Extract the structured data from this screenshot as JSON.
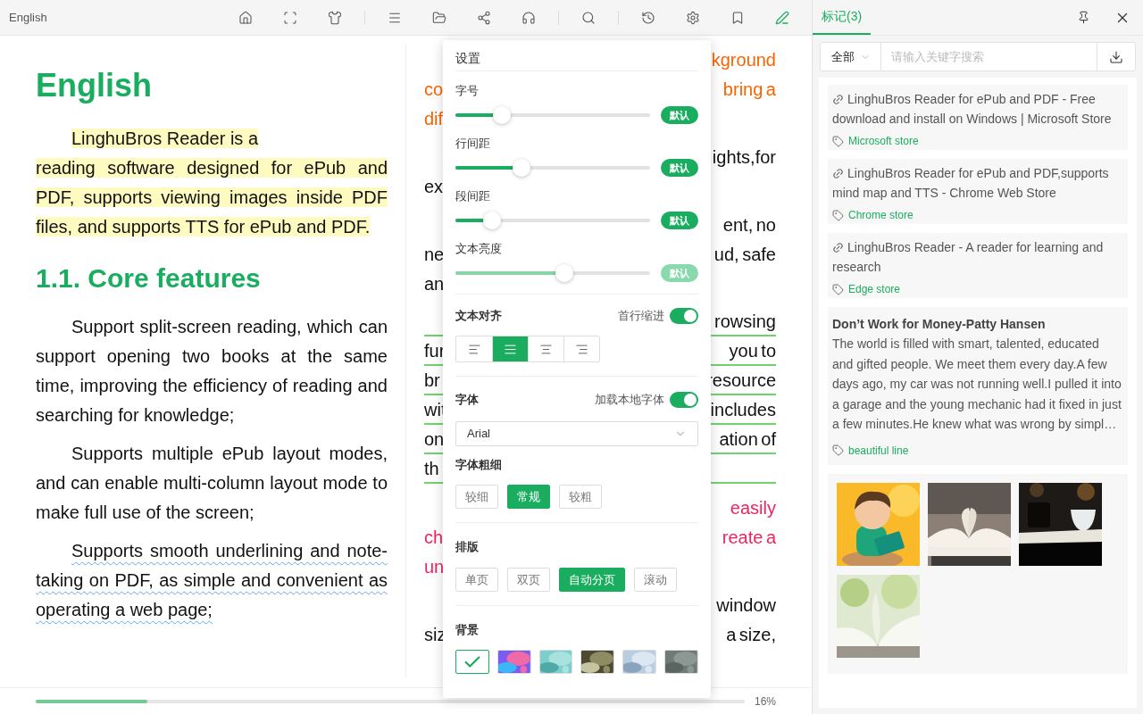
{
  "toolbar": {
    "title": "English",
    "tool_groups": [
      [
        {
          "kind": "home",
          "selected": false
        },
        {
          "kind": "fullscreen",
          "selected": false
        },
        {
          "kind": "theme",
          "selected": false
        }
      ],
      [
        {
          "kind": "contents",
          "selected": false
        },
        {
          "kind": "files",
          "selected": false
        },
        {
          "kind": "mindmap",
          "selected": false
        },
        {
          "kind": "listen",
          "selected": false
        }
      ],
      [
        {
          "kind": "search",
          "selected": false
        }
      ],
      [
        {
          "kind": "history",
          "selected": false
        },
        {
          "kind": "settings",
          "selected": false
        },
        {
          "kind": "bookmark",
          "selected": false
        },
        {
          "kind": "annotate",
          "selected": true
        }
      ]
    ]
  },
  "reader": {
    "left_column": [
      {
        "kind": "heading1",
        "text": "English"
      },
      {
        "kind": "highlight",
        "text": "LinghuBros Reader is a\nreading software designed for ePub and PDF, supports viewing images inside PDF files, and supports TTS for ePub and PDF."
      },
      {
        "kind": "heading2",
        "text": "1.1. Core features"
      },
      {
        "kind": "plain",
        "text": "Support split-screen reading, which can support opening two books at the same time, improving the efficiency of reading and searching for knowledge;"
      },
      {
        "kind": "plain",
        "text": "Supports multiple ePub layout modes, and can enable multi-column layout mode to make full use of the screen;"
      },
      {
        "kind": "wavy",
        "text": "Supports smooth underlining and note-taking on PDF, as simple and convenient as operating a web page;"
      }
    ],
    "right_column": [
      {
        "kind": "orange",
        "lines": [
          {
            "right": "kground"
          },
          {
            "left": "co",
            "right": "bring a"
          },
          {
            "left": "dif"
          }
        ]
      },
      {
        "kind": "plain",
        "lines": [
          {
            "right": "ights,for"
          },
          {
            "left": "ex"
          }
        ]
      },
      {
        "kind": "plain",
        "lines": [
          {
            "right": "ent, no"
          },
          {
            "left": "ne",
            "right": "ud, safe"
          },
          {
            "left": "an"
          }
        ]
      },
      {
        "kind": "underline",
        "lines": [
          {
            "right": "rowsing"
          },
          {
            "left": "fur",
            "right": "you to"
          },
          {
            "left": "br",
            "right": "resource"
          },
          {
            "left": "wit",
            "right": "includes"
          },
          {
            "left": "on",
            "right": "ation of"
          },
          {
            "left": "th"
          }
        ]
      },
      {
        "kind": "pink",
        "lines": [
          {
            "right": "easily"
          },
          {
            "left": "ch",
            "right": "reate a"
          },
          {
            "left": "un"
          }
        ]
      },
      {
        "kind": "plain",
        "lines": [
          {
            "right": "window"
          },
          {
            "left": "siz",
            "right": "a size,"
          }
        ]
      }
    ]
  },
  "progress": {
    "level": 0.157,
    "percent": "16%"
  },
  "settings": {
    "title": "设置",
    "sliders": [
      {
        "label": "字号",
        "level": 0.24,
        "reset": "默认",
        "dimmed": false
      },
      {
        "label": "行间距",
        "level": 0.34,
        "reset": "默认",
        "dimmed": false
      },
      {
        "label": "段间距",
        "level": 0.19,
        "reset": "默认",
        "dimmed": false
      },
      {
        "label": "文本亮度",
        "level": 0.56,
        "reset": "默认",
        "dimmed": true
      }
    ],
    "alignment": {
      "label": "文本对齐",
      "toggle": {
        "label": "首行缩进",
        "on": true
      },
      "options": [
        {
          "kind": "left",
          "selected": false
        },
        {
          "kind": "justify",
          "selected": true
        },
        {
          "kind": "center",
          "selected": false
        },
        {
          "kind": "right",
          "selected": false
        }
      ]
    },
    "font": {
      "label": "字体",
      "toggle": {
        "label": "加载本地字体",
        "on": true
      },
      "value": "Arial"
    },
    "weight": {
      "label": "字体粗细",
      "options": [
        {
          "text": "较细",
          "selected": false
        },
        {
          "text": "常规",
          "selected": true
        },
        {
          "text": "较粗",
          "selected": false
        }
      ]
    },
    "layout": {
      "label": "排版",
      "options": [
        {
          "text": "单页",
          "selected": false
        },
        {
          "text": "双页",
          "selected": false
        },
        {
          "text": "自动分页",
          "selected": true
        },
        {
          "text": "滚动",
          "selected": false
        }
      ]
    },
    "background": {
      "label": "背景",
      "swatches": [
        {
          "kind": "plain",
          "selected": true
        },
        {
          "kind": "picture",
          "selected": false
        },
        {
          "kind": "picture",
          "selected": false
        },
        {
          "kind": "picture",
          "selected": false
        },
        {
          "kind": "picture",
          "selected": false
        },
        {
          "kind": "picture",
          "selected": false
        }
      ]
    }
  },
  "side_panel": {
    "tab": {
      "label": "标记(3)",
      "selected": true
    },
    "filter": {
      "value": "全部"
    },
    "search": {
      "placeholder": "请输入关键字搜索"
    },
    "items": [
      {
        "kind": "link",
        "text": "LinghuBros Reader for ePub and PDF - Free download and install on Windows | Microsoft Store",
        "tag": "Microsoft store"
      },
      {
        "kind": "link",
        "text": "LinghuBros Reader for ePub and PDF,supports mind map and TTS - Chrome Web Store",
        "tag": "Chrome store"
      },
      {
        "kind": "link",
        "text": "LinghuBros Reader - A reader for learning and research",
        "tag": "Edge store"
      },
      {
        "kind": "note",
        "title": "Don’t Work for Money-Patty Hansen",
        "text": "The world is filled with smart, talented, educated and gifted people. We meet them every day.A few days ago, my car was not running well.I pulled it into a garage and the young mechanic had it fixed in just a few minutes.He knew what was wrong by simpl…",
        "tag": "beautiful line"
      },
      {
        "kind": "images",
        "pictures": [
          {
            "kind": "picture"
          },
          {
            "kind": "picture"
          },
          {
            "kind": "picture"
          },
          {
            "kind": "picture"
          }
        ]
      }
    ]
  }
}
